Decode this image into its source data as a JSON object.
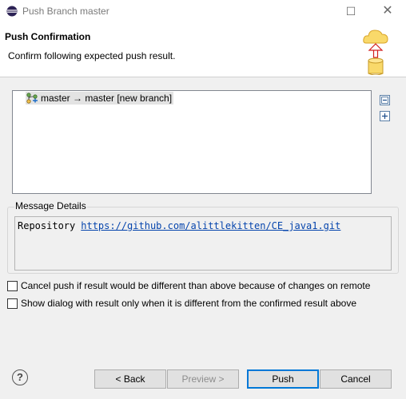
{
  "window": {
    "title": "Push Branch master",
    "maximize_icon": "☐",
    "close_icon": "✕"
  },
  "header": {
    "title": "Push Confirmation",
    "description": "Confirm following expected push result."
  },
  "push_tree": {
    "items": [
      {
        "label": "master → master [new branch]",
        "icon": "branch-icon",
        "selected": true
      }
    ],
    "collapse_all_icon": "collapse-all-icon",
    "expand_all_icon": "expand-all-icon"
  },
  "message_details": {
    "label": "Message Details",
    "repository_label": "Repository",
    "repository_url": "https://github.com/alittlekitten/CE_java1.git"
  },
  "options": {
    "cancel_if_different": "Cancel push if result would be different than above because of changes on remote",
    "show_dialog_if_different": "Show dialog with result only when it is different from the confirmed result above"
  },
  "buttons": {
    "help": "?",
    "back": "< Back",
    "preview": "Preview >",
    "push": "Push",
    "cancel": "Cancel"
  },
  "colors": {
    "link": "#0645ad",
    "default_button_border": "#0078d7"
  }
}
